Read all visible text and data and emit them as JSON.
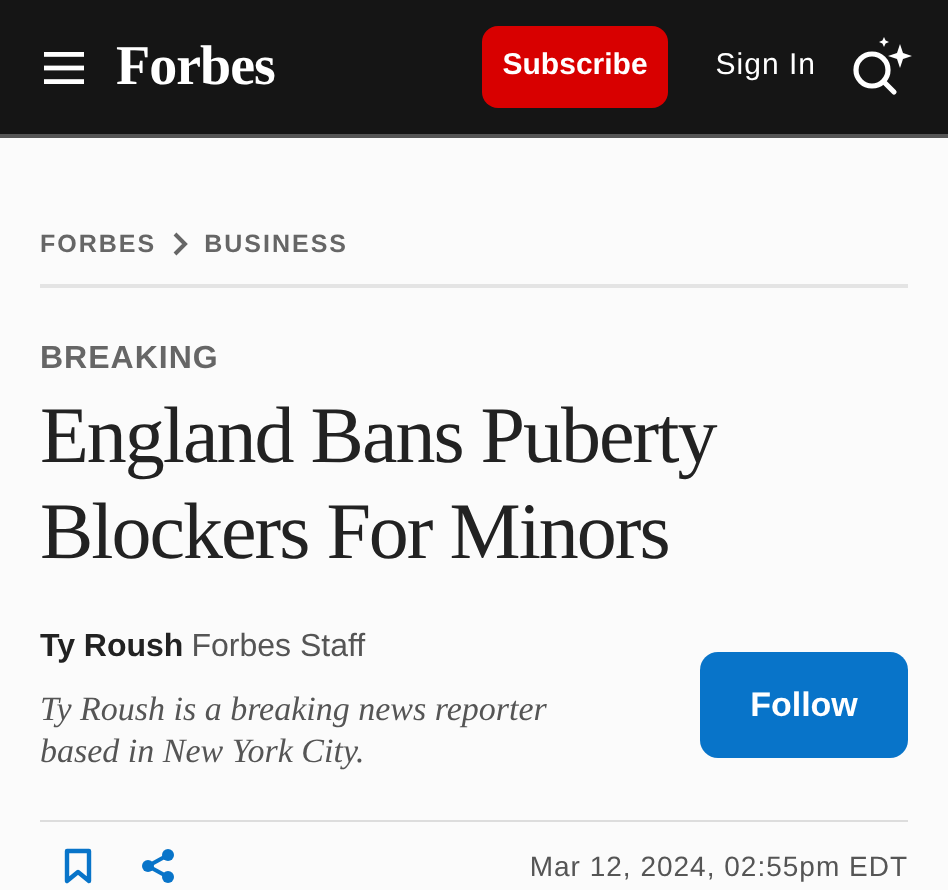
{
  "header": {
    "logo": "Forbes",
    "subscribe": "Subscribe",
    "sign_in": "Sign In"
  },
  "breadcrumb": [
    "FORBES",
    "BUSINESS"
  ],
  "label": "BREAKING",
  "headline": "England Bans Puberty Blockers For Minors",
  "author": {
    "name": "Ty Roush",
    "role": "Forbes Staff",
    "bio": "Ty Roush is a breaking news reporter based in New York City.",
    "follow": "Follow"
  },
  "date": "Mar 12, 2024, 02:55pm EDT"
}
